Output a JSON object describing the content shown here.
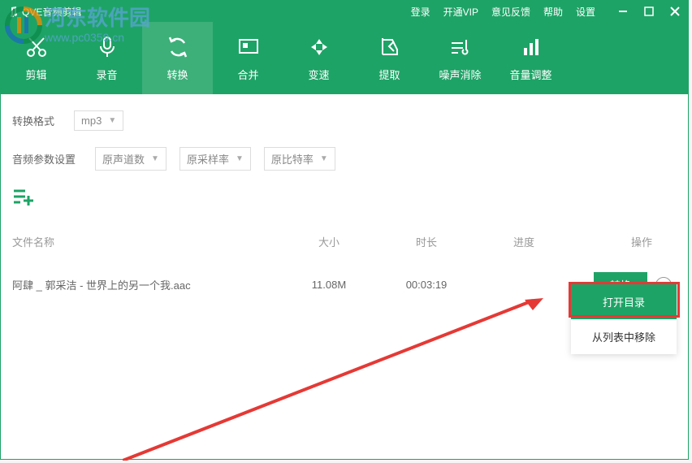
{
  "app": {
    "title": "QVE音频剪辑"
  },
  "titlebar": {
    "login": "登录",
    "vip": "开通VIP",
    "feedback": "意见反馈",
    "help": "帮助",
    "settings": "设置"
  },
  "tabs": [
    {
      "label": "剪辑",
      "icon": "cut"
    },
    {
      "label": "录音",
      "icon": "mic"
    },
    {
      "label": "转换",
      "icon": "convert",
      "active": true
    },
    {
      "label": "合并",
      "icon": "merge"
    },
    {
      "label": "变速",
      "icon": "speed"
    },
    {
      "label": "提取",
      "icon": "extract"
    },
    {
      "label": "噪声消除",
      "icon": "noise"
    },
    {
      "label": "音量调整",
      "icon": "volume"
    }
  ],
  "fields": {
    "format_label": "转换格式"
  },
  "format_select": {
    "value": "mp3"
  },
  "param": {
    "label": "音频参数设置",
    "channels": "原声道数",
    "sample_rate": "原采样率",
    "bitrate": "原比特率"
  },
  "columns": {
    "name": "文件名称",
    "size": "大小",
    "duration": "时长",
    "progress": "进度",
    "action": "操作"
  },
  "rows": [
    {
      "name": "阿肆 _ 郭采洁 - 世界上的另一个我.aac",
      "size": "11.08M",
      "duration": "00:03:19",
      "progress": "",
      "action": "转换"
    }
  ],
  "context_menu": {
    "open_dir": "打开目录",
    "remove": "从列表中移除"
  },
  "watermark": {
    "line1": "河东软件园",
    "line2": "www.pc0359.cn"
  }
}
